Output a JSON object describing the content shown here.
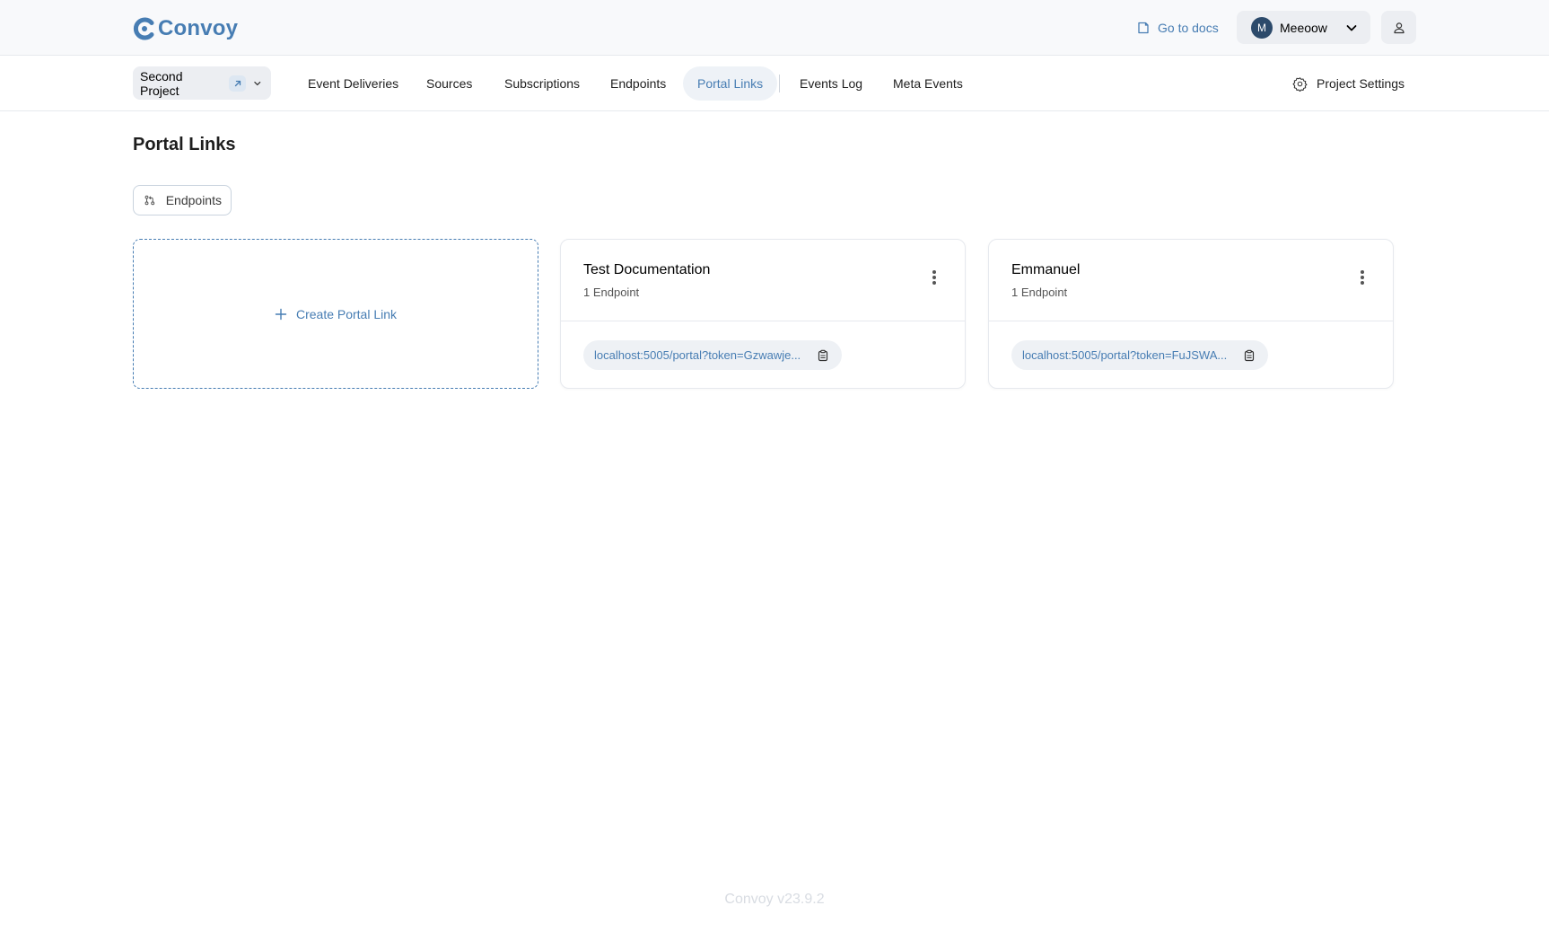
{
  "app": {
    "brand": "Convoy",
    "accent": "#477db3"
  },
  "header": {
    "docs_label": "Go to docs",
    "org": {
      "initial": "M",
      "name": "Meeoow"
    }
  },
  "nav": {
    "project": "Second Project",
    "items": [
      {
        "label": "Event Deliveries",
        "active": false
      },
      {
        "label": "Sources",
        "active": false
      },
      {
        "label": "Subscriptions",
        "active": false
      },
      {
        "label": "Endpoints",
        "active": false
      },
      {
        "label": "Portal Links",
        "active": true
      },
      {
        "label": "Events Log",
        "active": false
      },
      {
        "label": "Meta Events",
        "active": false
      }
    ],
    "settings_label": "Project Settings"
  },
  "main": {
    "title": "Portal Links",
    "filter_label": "Endpoints",
    "create_label": "Create Portal Link",
    "cards": [
      {
        "name": "Test Documentation",
        "endpoints": "1 Endpoint",
        "url": "localhost:5005/portal?token=Gzwawje..."
      },
      {
        "name": "Emmanuel",
        "endpoints": "1 Endpoint",
        "url": "localhost:5005/portal?token=FuJSWA..."
      }
    ]
  },
  "footer": {
    "version": "Convoy v23.9.2"
  }
}
